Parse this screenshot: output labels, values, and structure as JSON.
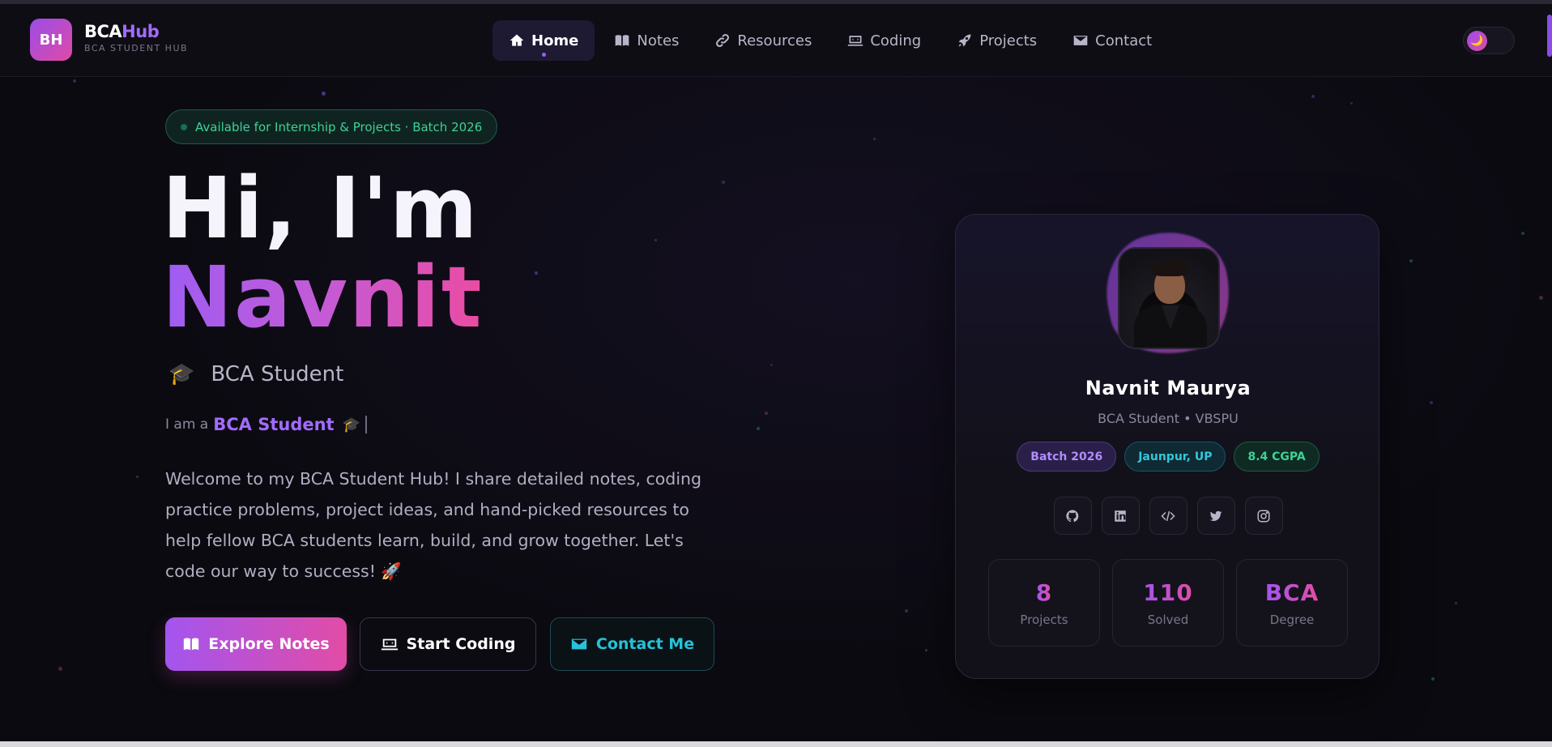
{
  "brand": {
    "logo_text": "BH",
    "name_part1": "BCA",
    "name_part2": "Hub",
    "subtitle": "BCA STUDENT HUB"
  },
  "nav": {
    "items": [
      {
        "label": "Home",
        "icon": "home-icon",
        "active": true
      },
      {
        "label": "Notes",
        "icon": "book-icon",
        "active": false
      },
      {
        "label": "Resources",
        "icon": "link-icon",
        "active": false
      },
      {
        "label": "Coding",
        "icon": "laptop-code-icon",
        "active": false
      },
      {
        "label": "Projects",
        "icon": "rocket-icon",
        "active": false
      },
      {
        "label": "Contact",
        "icon": "envelope-icon",
        "active": false
      }
    ],
    "theme_toggle_icon": "🌙"
  },
  "hero": {
    "badge": "Available for Internship & Projects · Batch 2026",
    "greeting": "Hi, I'm",
    "name": "Navnit",
    "role_emoji": "🎓",
    "role": "BCA Student",
    "typed_prefix": "I am a",
    "typed_word": "BCA Student",
    "typed_emoji": "🎓",
    "intro": "Welcome to my BCA Student Hub! I share detailed notes, coding practice problems, project ideas, and hand-picked resources to help fellow BCA students learn, build, and grow together. Let's code our way to success! 🚀",
    "buttons": {
      "notes": "Explore Notes",
      "coding": "Start Coding",
      "contact": "Contact Me"
    }
  },
  "card": {
    "name": "Navnit Maurya",
    "subtitle": "BCA Student • VBSPU",
    "chips": [
      "Batch 2026",
      "Jaunpur, UP",
      "8.4 CGPA"
    ],
    "socials": [
      "github-icon",
      "linkedin-icon",
      "code-icon",
      "twitter-icon",
      "instagram-icon"
    ],
    "stats": [
      {
        "value": "8",
        "label": "Projects"
      },
      {
        "value": "110",
        "label": "Solved"
      },
      {
        "value": "BCA",
        "label": "Degree"
      }
    ]
  },
  "colors": {
    "accent_purple": "#a355ef",
    "accent_pink": "#e24ca6",
    "accent_teal": "#26c3d8",
    "accent_green": "#3ed198",
    "background": "#0b0a10"
  }
}
